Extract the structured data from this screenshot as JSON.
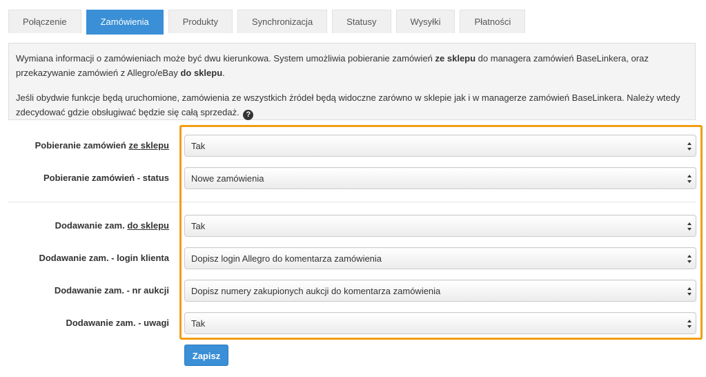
{
  "tabs": [
    {
      "label": "Połączenie"
    },
    {
      "label": "Zamówienia"
    },
    {
      "label": "Produkty"
    },
    {
      "label": "Synchronizacja"
    },
    {
      "label": "Statusy"
    },
    {
      "label": "Wysyłki"
    },
    {
      "label": "Płatności"
    }
  ],
  "active_tab": "Zamówienia",
  "info": {
    "p1_a": "Wymiana informacji o zamówieniach może być dwu kierunkowa. System umożliwia pobieranie zamówień ",
    "p1_b": "ze sklepu",
    "p1_c": " do managera zamówień BaseLinkera, oraz przekazywanie zamówień z Allegro/eBay ",
    "p1_d": "do sklepu",
    "p1_e": ".",
    "p2": "Jeśli obydwie funkcje będą uruchomione, zamówienia ze wszystkich źródeł będą widoczne zarówno w sklepie jak i w managerze zamówień BaseLinkera. Należy wtedy zdecydować gdzie obsługiwać będzie się całą sprzedaż.",
    "help_glyph": "?"
  },
  "fields": {
    "download_orders": {
      "label_prefix": "Pobieranie zamówień ",
      "label_underlined": "ze sklepu",
      "value": "Tak"
    },
    "download_status": {
      "label": "Pobieranie zamówień - status",
      "value": "Nowe zamówienia"
    },
    "add_orders": {
      "label_prefix": "Dodawanie zam. ",
      "label_underlined": "do sklepu",
      "value": "Tak"
    },
    "add_login": {
      "label": "Dodawanie zam. - login klienta",
      "value": "Dopisz login Allegro do komentarza zamówienia"
    },
    "add_auction_numbers": {
      "label": "Dodawanie zam. - nr aukcji",
      "value": "Dopisz numery zakupionych aukcji do komentarza zamówienia"
    },
    "add_notes": {
      "label": "Dodawanie zam. - uwagi",
      "value": "Tak"
    }
  },
  "save_label": "Zapisz",
  "colors": {
    "accent": "#3a8fd6",
    "highlight": "#f39c12"
  }
}
